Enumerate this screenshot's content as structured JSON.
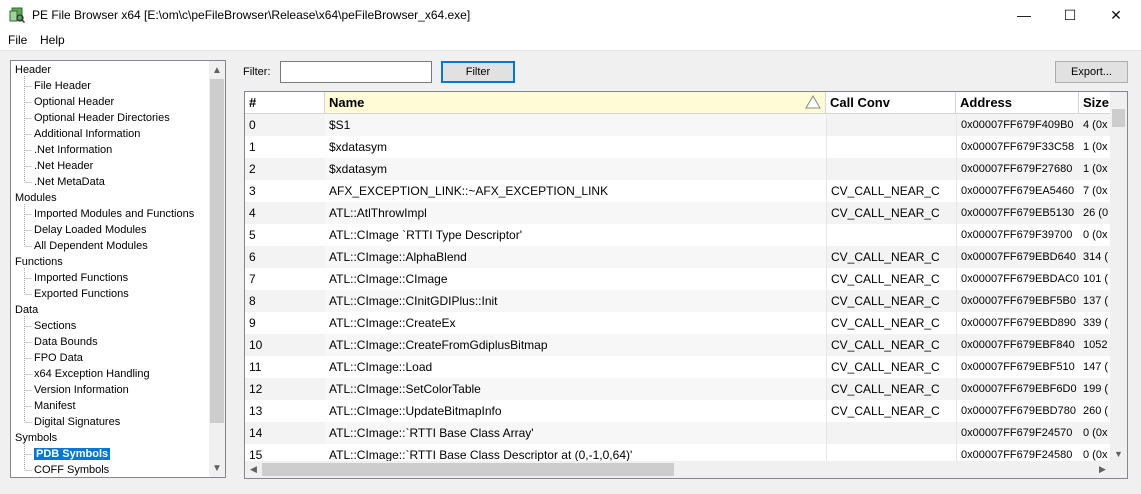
{
  "window": {
    "title": "PE File Browser x64 [E:\\om\\c\\peFileBrowser\\Release\\x64\\peFileBrowser_x64.exe]",
    "minimize_glyph": "—",
    "maximize_glyph": "☐",
    "close_glyph": "✕"
  },
  "menu": {
    "file": "File",
    "help": "Help"
  },
  "tree": [
    {
      "label": "Header",
      "group": true
    },
    {
      "label": "File Header"
    },
    {
      "label": "Optional Header"
    },
    {
      "label": "Optional Header Directories"
    },
    {
      "label": "Additional Information"
    },
    {
      "label": ".Net Information"
    },
    {
      "label": ".Net Header"
    },
    {
      "label": ".Net MetaData"
    },
    {
      "label": "Modules",
      "group": true
    },
    {
      "label": "Imported Modules and Functions"
    },
    {
      "label": "Delay Loaded Modules"
    },
    {
      "label": "All Dependent Modules"
    },
    {
      "label": "Functions",
      "group": true
    },
    {
      "label": "Imported Functions"
    },
    {
      "label": "Exported Functions"
    },
    {
      "label": "Data",
      "group": true
    },
    {
      "label": "Sections"
    },
    {
      "label": "Data Bounds"
    },
    {
      "label": "FPO Data"
    },
    {
      "label": "x64 Exception Handling"
    },
    {
      "label": "Version Information"
    },
    {
      "label": "Manifest"
    },
    {
      "label": "Digital Signatures"
    },
    {
      "label": "Symbols",
      "group": true
    },
    {
      "label": "PDB Symbols",
      "selected": true
    },
    {
      "label": "COFF Symbols"
    }
  ],
  "toolbar": {
    "filter_label": "Filter:",
    "filter_value": "",
    "filter_button": "Filter",
    "export_button": "Export..."
  },
  "table": {
    "columns": [
      "#",
      "Name",
      "Call Conv",
      "Address",
      "Size"
    ],
    "sorted_column": "Name",
    "rows": [
      [
        "0",
        "$S1",
        "",
        "0x00007FF679F409B0",
        "4 (0x"
      ],
      [
        "1",
        "$xdatasym",
        "",
        "0x00007FF679F33C58",
        "1 (0x"
      ],
      [
        "2",
        "$xdatasym",
        "",
        "0x00007FF679F27680",
        "1 (0x"
      ],
      [
        "3",
        "AFX_EXCEPTION_LINK::~AFX_EXCEPTION_LINK",
        "CV_CALL_NEAR_C",
        "0x00007FF679EA5460",
        "7 (0x"
      ],
      [
        "4",
        "ATL::AtlThrowImpl",
        "CV_CALL_NEAR_C",
        "0x00007FF679EB5130",
        "26 (0"
      ],
      [
        "5",
        "ATL::CImage `RTTI Type Descriptor'",
        "",
        "0x00007FF679F39700",
        "0 (0x"
      ],
      [
        "6",
        "ATL::CImage::AlphaBlend",
        "CV_CALL_NEAR_C",
        "0x00007FF679EBD640",
        "314 ("
      ],
      [
        "7",
        "ATL::CImage::CImage",
        "CV_CALL_NEAR_C",
        "0x00007FF679EBDAC0",
        "101 ("
      ],
      [
        "8",
        "ATL::CImage::CInitGDIPlus::Init",
        "CV_CALL_NEAR_C",
        "0x00007FF679EBF5B0",
        "137 ("
      ],
      [
        "9",
        "ATL::CImage::CreateEx",
        "CV_CALL_NEAR_C",
        "0x00007FF679EBD890",
        "339 ("
      ],
      [
        "10",
        "ATL::CImage::CreateFromGdiplusBitmap",
        "CV_CALL_NEAR_C",
        "0x00007FF679EBF840",
        "1052"
      ],
      [
        "11",
        "ATL::CImage::Load",
        "CV_CALL_NEAR_C",
        "0x00007FF679EBF510",
        "147 ("
      ],
      [
        "12",
        "ATL::CImage::SetColorTable",
        "CV_CALL_NEAR_C",
        "0x00007FF679EBF6D0",
        "199 ("
      ],
      [
        "13",
        "ATL::CImage::UpdateBitmapInfo",
        "CV_CALL_NEAR_C",
        "0x00007FF679EBD780",
        "260 ("
      ],
      [
        "14",
        "ATL::CImage::`RTTI Base Class Array'",
        "",
        "0x00007FF679F24570",
        "0 (0x"
      ],
      [
        "15",
        "ATL::CImage::`RTTI Base Class Descriptor at (0,-1,0,64)'",
        "",
        "0x00007FF679F24580",
        "0 (0x"
      ]
    ]
  },
  "colors": {
    "selection": "#0078d7",
    "sorted_header": "#fffbd6",
    "alt_row": "#f3f3f3"
  }
}
